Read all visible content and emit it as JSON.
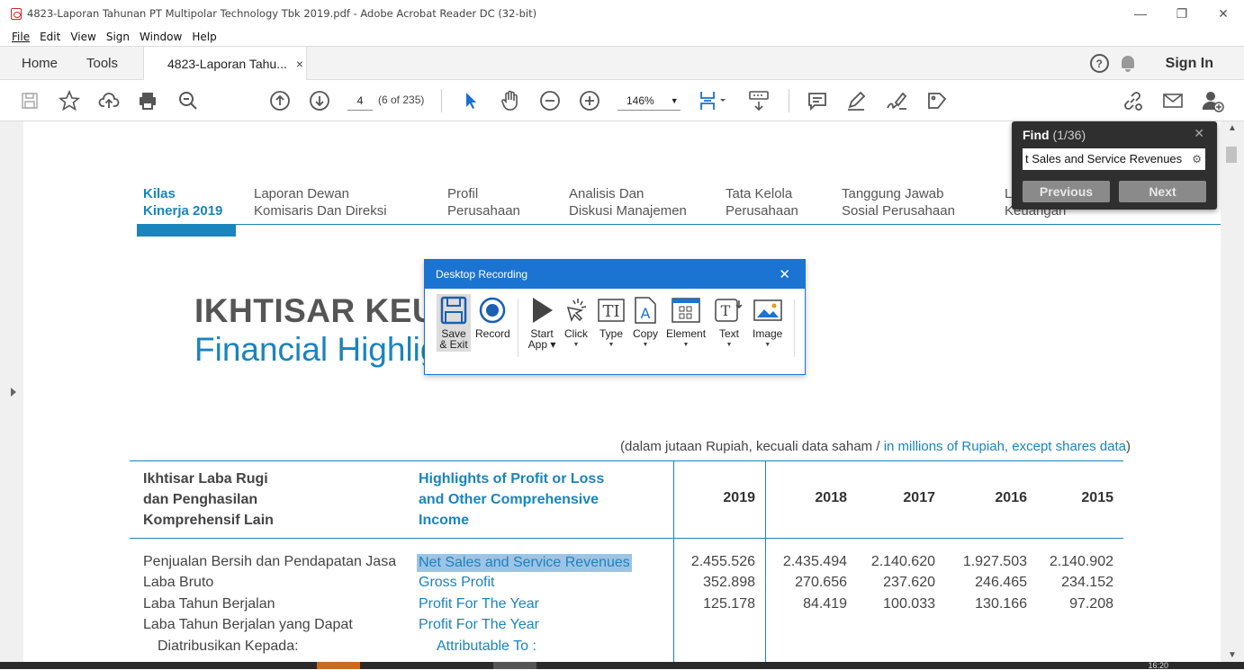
{
  "window": {
    "title": "4823-Laporan Tahunan PT Multipolar Technology Tbk 2019.pdf - Adobe Acrobat Reader DC (32-bit)"
  },
  "menu": [
    "File",
    "Edit",
    "View",
    "Sign",
    "Window",
    "Help"
  ],
  "tabs": {
    "home": "Home",
    "tools": "Tools",
    "doc": "4823-Laporan Tahu...",
    "close": "×",
    "sign_in": "Sign In"
  },
  "toolbar": {
    "page_value": "4",
    "page_of": "(6 of 235)",
    "zoom": "146%",
    "zoom_caret": "▼"
  },
  "find": {
    "label": "Find",
    "count": "(1/36)",
    "close": "✕",
    "query": "t Sales and Service Revenues",
    "previous": "Previous",
    "next": "Next"
  },
  "recording": {
    "title": "Desktop Recording",
    "close": "✕",
    "buttons": {
      "save": [
        "Save",
        "& Exit"
      ],
      "record": "Record",
      "start": [
        "Start",
        "App ▾"
      ],
      "click": "Click",
      "type": "Type",
      "copy": "Copy",
      "element": "Element",
      "text": "Text",
      "image": "Image"
    },
    "dropdown": "▼"
  },
  "document": {
    "nav": [
      {
        "line1": "Kilas",
        "line2": "Kinerja 2019"
      },
      {
        "line1": "Laporan Dewan",
        "line2": "Komisaris Dan Direksi"
      },
      {
        "line1": "Profil",
        "line2": "Perusahaan"
      },
      {
        "line1": "Analisis Dan",
        "line2": "Diskusi Manajemen"
      },
      {
        "line1": "Tata Kelola",
        "line2": "Perusahaan"
      },
      {
        "line1": "Tanggung Jawab",
        "line2": "Sosial Perusahaan"
      },
      {
        "line1": "L",
        "line2": "Keuangan"
      }
    ],
    "title": "IKHTISAR KEU",
    "subtitle": "Financial Highligh",
    "units_id": "(dalam jutaan Rupiah, kecuali data saham / ",
    "units_en": "in millions of Rupiah, except shares data",
    "units_close": ")",
    "header_id": [
      "Ikhtisar Laba Rugi",
      "dan Penghasilan",
      "Komprehensif Lain"
    ],
    "header_en": [
      "Highlights of Profit or Loss",
      "and Other Comprehensive",
      "Income"
    ],
    "years": [
      "2019",
      "2018",
      "2017",
      "2016",
      "2015"
    ],
    "rows": [
      {
        "id": "Penjualan Bersih dan Pendapatan Jasa",
        "en": "Net Sales and Service Revenues",
        "values": [
          "2.455.526",
          "2.435.494",
          "2.140.620",
          "1.927.503",
          "2.140.902"
        ]
      },
      {
        "id": "Laba Bruto",
        "en": "Gross Profit",
        "values": [
          "352.898",
          "270.656",
          "237.620",
          "246.465",
          "234.152"
        ]
      },
      {
        "id": "Laba Tahun Berjalan",
        "en": "Profit For The Year",
        "values": [
          "125.178",
          "84.419",
          "100.033",
          "130.166",
          "97.208"
        ]
      },
      {
        "id": "Laba Tahun Berjalan yang Dapat",
        "en": "Profit For The Year",
        "values": [
          "",
          "",
          "",
          "",
          ""
        ]
      },
      {
        "id": "Diatribusikan Kepada:",
        "en": "Attributable To :",
        "values": [
          "",
          "",
          "",
          "",
          ""
        ]
      }
    ]
  },
  "taskbar": {
    "clock": "16:20"
  },
  "colors": {
    "accent": "#1a84bd",
    "recording": "#1b74d1",
    "highlight": "#9dc3e6"
  }
}
